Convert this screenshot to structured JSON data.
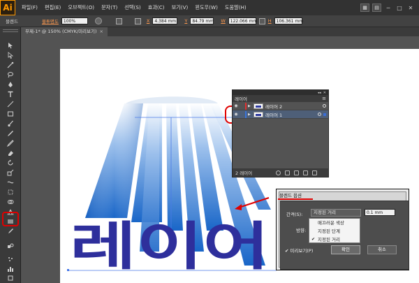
{
  "app": {
    "logo": "Ai"
  },
  "menubar": {
    "items": [
      "파일(F)",
      "편집(E)",
      "오브젝트(O)",
      "문자(T)",
      "선택(S)",
      "효과(C)",
      "보기(V)",
      "윈도우(W)",
      "도움말(H)"
    ],
    "minimize": "─",
    "restore": "□",
    "close": "✕"
  },
  "controlbar": {
    "tool_name": "블렌드",
    "opacity_label": "불투명도",
    "opacity_value": "100%",
    "x_label": "X",
    "x_value": "4.384 mm",
    "y_label": "Y",
    "y_value": "84.79 mm",
    "w_label": "W",
    "w_value": "122.066 mm",
    "h_label": "H",
    "h_value": "106.361 mm"
  },
  "document_tab": {
    "title": "무제-1* @ 150% (CMYK/미리보기)",
    "close": "×"
  },
  "toolbar": {
    "tools": [
      "selection-icon",
      "direct-selection-icon",
      "magic-wand-icon",
      "lasso-icon",
      "pen-icon",
      "type-icon",
      "line-icon",
      "rectangle-icon",
      "paintbrush-icon",
      "pencil-icon",
      "blob-brush-icon",
      "eraser-icon",
      "rotate-icon",
      "scale-icon",
      "width-icon",
      "free-transform-icon",
      "shape-builder-icon",
      "perspective-grid-icon",
      "mesh-icon",
      "gradient-icon",
      "eyedropper-icon",
      "blend-icon",
      "symbol-sprayer-icon",
      "graph-icon"
    ]
  },
  "canvas": {
    "artwork_text": "레이어"
  },
  "layers_panel": {
    "tab_label": "레이어",
    "collapse": "◂◂",
    "close": "✕",
    "menu": "≡",
    "layers": [
      {
        "name": "레이어 2",
        "color": "#e03030",
        "active": false
      },
      {
        "name": "레이어 1",
        "color": "#3a74d8",
        "active": true
      }
    ],
    "count_label": "2 레이어"
  },
  "blend_dialog": {
    "title": "블렌드 옵션",
    "spacing_label": "간격(S):",
    "spacing_selected": "지정된 거리",
    "spacing_value": "0.1 mm",
    "orientation_label": "방향:",
    "options": [
      "매끄러운 색상",
      "지정된 단계",
      "지정된 거리"
    ],
    "checked_index": 2,
    "preview_label": "미리보기(P)",
    "ok_label": "확인",
    "cancel_label": "취소"
  },
  "colors": {
    "annotation_red": "#e00000",
    "artwork_dark_blue": "#2e2f9c",
    "gradient_top": "#ffffff",
    "gradient_bottom": "#1966c8"
  }
}
